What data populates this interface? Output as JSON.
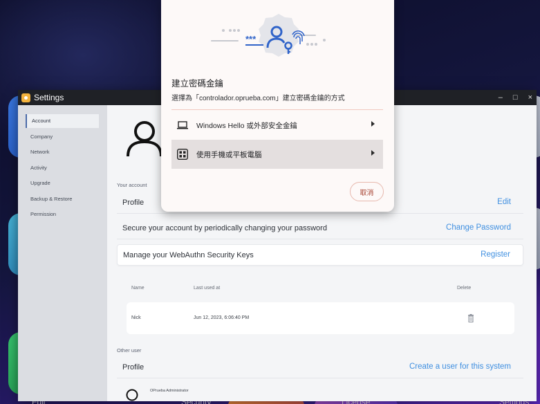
{
  "dock": {
    "labels": [
      "Full",
      "Security",
      "License",
      "Settings"
    ]
  },
  "window": {
    "title": "Settings",
    "controls": {
      "minimize": "–",
      "maximize": "□",
      "close": "×"
    }
  },
  "sidebar": {
    "items": [
      {
        "label": "Account",
        "active": true
      },
      {
        "label": "Company"
      },
      {
        "label": "Network"
      },
      {
        "label": "Activity"
      },
      {
        "label": "Upgrade"
      },
      {
        "label": "Backup & Restore"
      },
      {
        "label": "Permission"
      }
    ]
  },
  "account": {
    "section_label": "Your account",
    "profile": {
      "label": "Profile",
      "action": "Edit"
    },
    "password": {
      "label": "Secure your account by periodically changing your password",
      "action": "Change Password"
    },
    "webauthn": {
      "label": "Manage your WebAuthn Security Keys",
      "action": "Register"
    },
    "keys_table": {
      "headers": {
        "name": "Name",
        "last_used": "Last used at",
        "delete": "Delete"
      },
      "rows": [
        {
          "name": "Nick",
          "last_used": "Jun 12, 2023, 6:06:40 PM"
        }
      ]
    }
  },
  "other_user": {
    "section_label": "Other user",
    "profile": {
      "label": "Profile",
      "action": "Create a user for this system"
    },
    "user_name": "OPrueba Administrator"
  },
  "passkey_dialog": {
    "illustration_text": "***",
    "title": "建立密碼金鑰",
    "subtitle": "選擇為「controlador.oprueba.com」建立密碼金鑰的方式",
    "options": [
      {
        "label": "Windows Hello 或外部安全金鑰",
        "icon": "laptop-icon"
      },
      {
        "label": "使用手機或平板電腦",
        "icon": "qr-code-icon",
        "selected": true
      }
    ],
    "cancel": "取消"
  },
  "colors": {
    "link": "#3f8fe0",
    "sidebar_bg": "#dbdde2",
    "dialog_bg": "#fdf9f8",
    "cancel_text": "#a6412f",
    "illustration_blue": "#2f63c9"
  }
}
